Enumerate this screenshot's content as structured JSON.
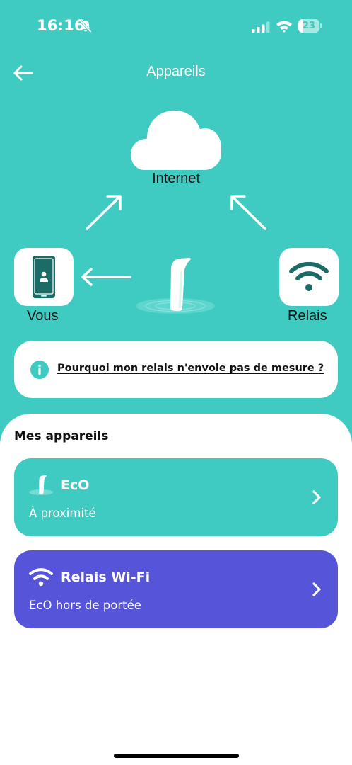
{
  "status_bar": {
    "time": "16:16",
    "battery": "23",
    "battery_level": 0.23,
    "icons": [
      "bell-slash-icon",
      "cellular-signal-icon",
      "wifi-icon",
      "battery-icon"
    ]
  },
  "nav": {
    "title": "Appareils",
    "back_icon": "arrow-left-icon"
  },
  "diagram": {
    "internet_label": "Internet",
    "you_label": "Vous",
    "relay_label": "Relais",
    "icons": [
      "cloud-icon",
      "smartphone-icon",
      "water-sensor-icon",
      "wifi-icon",
      "arrow-icon"
    ]
  },
  "info": {
    "icon": "info-icon",
    "link": "Pourquoi mon relais n'envoie pas de mesure ?"
  },
  "devices": {
    "title": "Mes appareils",
    "items": [
      {
        "name": "EcO",
        "status": "À proximité",
        "icon": "water-sensor-icon",
        "color": "#40CBC2"
      },
      {
        "name": "Relais Wi-Fi",
        "status": "EcO hors de portée",
        "icon": "wifi-icon",
        "color": "#5654D8"
      }
    ]
  },
  "colors": {
    "background": "#40CBC2",
    "accent_purple": "#5654D8",
    "dark_teal": "#1D6B66",
    "white": "#FFFFFF"
  }
}
